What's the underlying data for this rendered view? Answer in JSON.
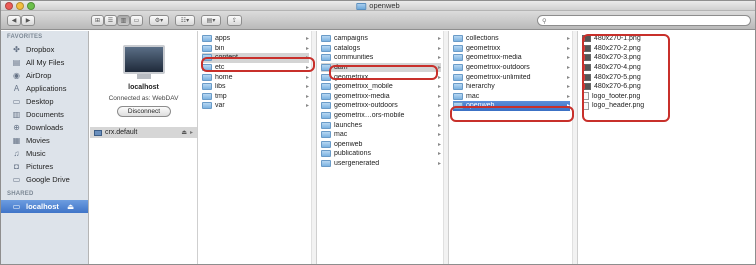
{
  "window": {
    "title": "openweb"
  },
  "toolbar": {
    "back": "◀",
    "forward": "▶",
    "view_icons": "⊞",
    "view_list": "☰",
    "view_columns": "▥",
    "view_coverflow": "▭",
    "action": "⚙▾",
    "arrange": "☷▾",
    "quicklook": "▤▾",
    "share": "⇪",
    "search_placeholder": ""
  },
  "sidebar": {
    "favorites_header": "FAVORITES",
    "favorites": [
      {
        "label": "Dropbox",
        "icon": "dropbox-icon",
        "glyph": "✤"
      },
      {
        "label": "All My Files",
        "icon": "all-files-icon",
        "glyph": "▤"
      },
      {
        "label": "AirDrop",
        "icon": "airdrop-icon",
        "glyph": "◉"
      },
      {
        "label": "Applications",
        "icon": "applications-icon",
        "glyph": "A"
      },
      {
        "label": "Desktop",
        "icon": "desktop-icon",
        "glyph": "▭"
      },
      {
        "label": "Documents",
        "icon": "documents-icon",
        "glyph": "▥"
      },
      {
        "label": "Downloads",
        "icon": "downloads-icon",
        "glyph": "⊕"
      },
      {
        "label": "Movies",
        "icon": "movies-icon",
        "glyph": "▦"
      },
      {
        "label": "Music",
        "icon": "music-icon",
        "glyph": "♫"
      },
      {
        "label": "Pictures",
        "icon": "pictures-icon",
        "glyph": "◘"
      },
      {
        "label": "Google Drive",
        "icon": "google-drive-icon",
        "glyph": "▭"
      }
    ],
    "shared_header": "SHARED",
    "shared": [
      {
        "label": "localhost",
        "icon": "server-icon",
        "glyph": "▭",
        "eject": "⏏"
      }
    ]
  },
  "preview": {
    "host": "localhost",
    "connected": "Connected as: WebDAV",
    "disconnect": "Disconnect",
    "volume": "crx.default",
    "eject": "⏏",
    "arrow": "▸"
  },
  "columns": [
    {
      "items": [
        {
          "label": "apps",
          "type": "folder"
        },
        {
          "label": "bin",
          "type": "folder"
        },
        {
          "label": "content",
          "type": "folder",
          "state": "selected-gray"
        },
        {
          "label": "etc",
          "type": "folder"
        },
        {
          "label": "home",
          "type": "folder"
        },
        {
          "label": "libs",
          "type": "folder"
        },
        {
          "label": "tmp",
          "type": "folder"
        },
        {
          "label": "var",
          "type": "folder"
        }
      ]
    },
    {
      "items": [
        {
          "label": "campaigns",
          "type": "folder"
        },
        {
          "label": "catalogs",
          "type": "folder"
        },
        {
          "label": "communities",
          "type": "folder"
        },
        {
          "label": "dam",
          "type": "folder",
          "state": "selected-gray"
        },
        {
          "label": "geometrixx",
          "type": "folder"
        },
        {
          "label": "geometrixx_mobile",
          "type": "folder"
        },
        {
          "label": "geometrixx-media",
          "type": "folder"
        },
        {
          "label": "geometrixx-outdoors",
          "type": "folder"
        },
        {
          "label": "geometrix…ors-mobile",
          "type": "folder"
        },
        {
          "label": "launches",
          "type": "folder"
        },
        {
          "label": "mac",
          "type": "folder"
        },
        {
          "label": "openweb",
          "type": "folder"
        },
        {
          "label": "publications",
          "type": "folder"
        },
        {
          "label": "usergenerated",
          "type": "folder"
        }
      ]
    },
    {
      "items": [
        {
          "label": "collections",
          "type": "folder"
        },
        {
          "label": "geometrixx",
          "type": "folder"
        },
        {
          "label": "geometrixx-media",
          "type": "folder"
        },
        {
          "label": "geometrixx-outdoors",
          "type": "folder"
        },
        {
          "label": "geometrixx-unlimited",
          "type": "folder"
        },
        {
          "label": "hierarchy",
          "type": "folder"
        },
        {
          "label": "mac",
          "type": "folder"
        },
        {
          "label": "openweb",
          "type": "folder",
          "state": "selected-blue"
        }
      ]
    },
    {
      "items": [
        {
          "label": "480x270-1.png",
          "type": "image"
        },
        {
          "label": "480x270-2.png",
          "type": "image"
        },
        {
          "label": "480x270-3.png",
          "type": "image"
        },
        {
          "label": "480x270-4.png",
          "type": "image"
        },
        {
          "label": "480x270-5.png",
          "type": "image"
        },
        {
          "label": "480x270-6.png",
          "type": "image"
        },
        {
          "label": "logo_footer.png",
          "type": "doc"
        },
        {
          "label": "logo_header.png",
          "type": "doc"
        }
      ]
    }
  ],
  "highlight_color": "#c8302b",
  "accent_color": "#3f74c8"
}
